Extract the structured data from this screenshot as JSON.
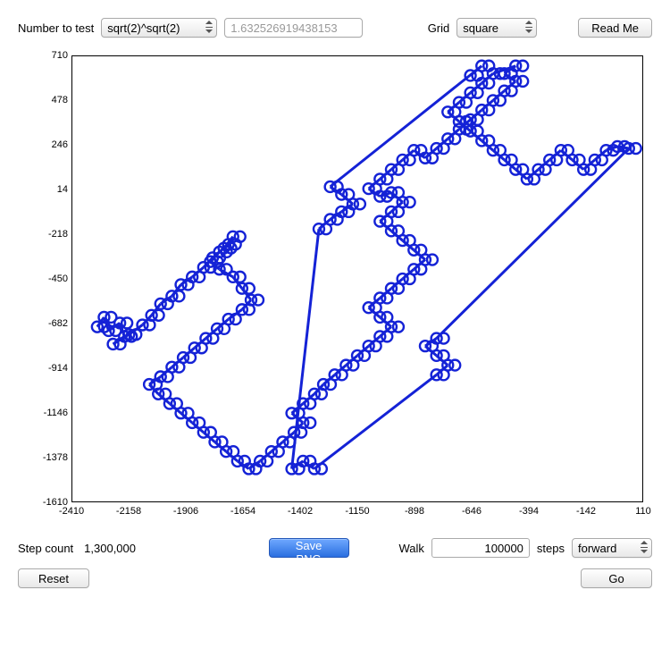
{
  "top": {
    "number_label": "Number to test",
    "number_select": "sqrt(2)^sqrt(2)",
    "number_value": "1.632526919438153",
    "grid_label": "Grid",
    "grid_select": "square",
    "readme_btn": "Read Me"
  },
  "chart_data": {
    "type": "scatter",
    "title": "",
    "xlabel": "",
    "ylabel": "",
    "xlim": [
      -2410,
      110
    ],
    "ylim": [
      -1610,
      710
    ],
    "xticks": [
      -2410,
      -2158,
      -1906,
      -1654,
      -1402,
      -1150,
      -898,
      -646,
      -394,
      -142,
      110
    ],
    "yticks": [
      -1610,
      -1378,
      -1146,
      -914,
      -682,
      -450,
      -218,
      14,
      246,
      478,
      710
    ],
    "series": [
      {
        "name": "walk",
        "color": "#1422d6",
        "points": [
          [
            -2300,
            -700
          ],
          [
            -2270,
            -650
          ],
          [
            -2250,
            -720
          ],
          [
            -2200,
            -680
          ],
          [
            -2180,
            -750
          ],
          [
            -2230,
            -790
          ],
          [
            -2160,
            -740
          ],
          [
            -2100,
            -690
          ],
          [
            -2060,
            -640
          ],
          [
            -2020,
            -580
          ],
          [
            -1970,
            -540
          ],
          [
            -1930,
            -480
          ],
          [
            -1880,
            -440
          ],
          [
            -1830,
            -390
          ],
          [
            -1790,
            -340
          ],
          [
            -1740,
            -290
          ],
          [
            -1700,
            -230
          ],
          [
            -1720,
            -270
          ],
          [
            -1760,
            -310
          ],
          [
            -1800,
            -360
          ],
          [
            -1760,
            -400
          ],
          [
            -1700,
            -440
          ],
          [
            -1660,
            -500
          ],
          [
            -1620,
            -560
          ],
          [
            -1660,
            -610
          ],
          [
            -1720,
            -660
          ],
          [
            -1770,
            -710
          ],
          [
            -1820,
            -760
          ],
          [
            -1870,
            -810
          ],
          [
            -1920,
            -860
          ],
          [
            -1970,
            -910
          ],
          [
            -2020,
            -960
          ],
          [
            -2070,
            -1000
          ],
          [
            -2030,
            -1050
          ],
          [
            -1980,
            -1100
          ],
          [
            -1930,
            -1150
          ],
          [
            -1880,
            -1200
          ],
          [
            -1830,
            -1250
          ],
          [
            -1780,
            -1300
          ],
          [
            -1730,
            -1350
          ],
          [
            -1680,
            -1400
          ],
          [
            -1630,
            -1440
          ],
          [
            -1580,
            -1400
          ],
          [
            -1530,
            -1350
          ],
          [
            -1480,
            -1300
          ],
          [
            -1430,
            -1250
          ],
          [
            -1390,
            -1200
          ],
          [
            -1440,
            -1150
          ],
          [
            -1390,
            -1100
          ],
          [
            -1340,
            -1050
          ],
          [
            -1300,
            -1000
          ],
          [
            -1250,
            -950
          ],
          [
            -1200,
            -900
          ],
          [
            -1150,
            -850
          ],
          [
            -1100,
            -800
          ],
          [
            -1050,
            -750
          ],
          [
            -1000,
            -700
          ],
          [
            -1050,
            -650
          ],
          [
            -1100,
            -600
          ],
          [
            -1050,
            -550
          ],
          [
            -1000,
            -500
          ],
          [
            -950,
            -450
          ],
          [
            -900,
            -400
          ],
          [
            -850,
            -350
          ],
          [
            -900,
            -300
          ],
          [
            -950,
            -250
          ],
          [
            -1000,
            -200
          ],
          [
            -1050,
            -150
          ],
          [
            -1000,
            -100
          ],
          [
            -950,
            -50
          ],
          [
            -1000,
            0
          ],
          [
            -1050,
            -20
          ],
          [
            -1100,
            20
          ],
          [
            -1050,
            70
          ],
          [
            -1000,
            120
          ],
          [
            -950,
            170
          ],
          [
            -900,
            220
          ],
          [
            -850,
            180
          ],
          [
            -800,
            230
          ],
          [
            -750,
            280
          ],
          [
            -700,
            330
          ],
          [
            -650,
            380
          ],
          [
            -600,
            430
          ],
          [
            -550,
            480
          ],
          [
            -500,
            530
          ],
          [
            -450,
            580
          ],
          [
            -500,
            620
          ],
          [
            -450,
            660
          ],
          [
            -550,
            620
          ],
          [
            -600,
            570
          ],
          [
            -650,
            520
          ],
          [
            -700,
            470
          ],
          [
            -750,
            420
          ],
          [
            -700,
            370
          ],
          [
            -650,
            320
          ],
          [
            -600,
            270
          ],
          [
            -550,
            220
          ],
          [
            -500,
            170
          ],
          [
            -450,
            120
          ],
          [
            -400,
            70
          ],
          [
            -350,
            120
          ],
          [
            -300,
            170
          ],
          [
            -250,
            220
          ],
          [
            -200,
            170
          ],
          [
            -150,
            120
          ],
          [
            -100,
            170
          ],
          [
            -50,
            220
          ],
          [
            0,
            240
          ],
          [
            50,
            230
          ],
          [
            -800,
            -760
          ],
          [
            -850,
            -800
          ],
          [
            -800,
            -850
          ],
          [
            -750,
            -900
          ],
          [
            -800,
            -950
          ],
          [
            -1340,
            -1440
          ],
          [
            -1390,
            -1400
          ],
          [
            -1440,
            -1440
          ],
          [
            -1320,
            -190
          ],
          [
            -1270,
            -140
          ],
          [
            -1220,
            -100
          ],
          [
            -1170,
            -60
          ],
          [
            -1220,
            -10
          ],
          [
            -1270,
            30
          ],
          [
            -600,
            660
          ],
          [
            -650,
            610
          ]
        ]
      }
    ]
  },
  "bottom": {
    "step_count_label": "Step count",
    "step_count_value": "1,300,000",
    "save_btn": "Save PNG",
    "walk_label": "Walk",
    "walk_value": "100000",
    "steps_label": "steps",
    "direction_select": "forward",
    "reset_btn": "Reset",
    "go_btn": "Go"
  }
}
